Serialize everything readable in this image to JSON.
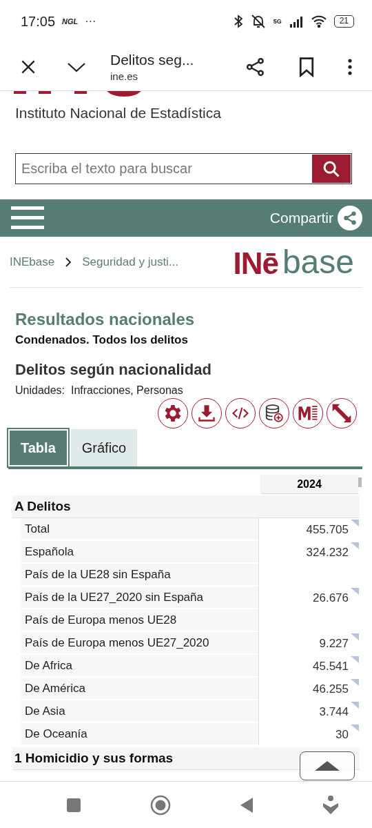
{
  "status_bar": {
    "time": "17:05",
    "carrier": "NGL",
    "more": "···",
    "network": "5G",
    "battery": "21"
  },
  "browser": {
    "title": "Delitos seg...",
    "url": "ine.es"
  },
  "site": {
    "name": "Instituto Nacional de Estadística",
    "search_placeholder": "Escriba el texto para buscar",
    "share_label": "Compartir"
  },
  "breadcrumb": [
    {
      "label": "INEbase"
    },
    {
      "label": "Seguridad y justi..."
    }
  ],
  "logo": {
    "left": "INē",
    "right": "base"
  },
  "section_title": "Resultados nacionales",
  "subtitle": "Condenados. Todos los delitos",
  "table_title": "Delitos según nacionalidad",
  "units_label": "Unidades:",
  "units": "Infracciones, Personas",
  "tools": [
    {
      "kind": "settings"
    },
    {
      "kind": "download"
    },
    {
      "kind": "embed"
    },
    {
      "kind": "database"
    },
    {
      "kind": "metadata"
    },
    {
      "kind": "expand"
    }
  ],
  "tabs": [
    {
      "label": "Tabla",
      "selected": true
    },
    {
      "label": "Gráfico",
      "selected": false
    }
  ],
  "table": {
    "columns": [
      "2024"
    ],
    "groups": [
      {
        "label": "A Delitos",
        "rows": [
          {
            "label": "Total",
            "value": "455.705"
          },
          {
            "label": "Española",
            "value": "324.232"
          },
          {
            "label": "País de la UE28 sin España"
          },
          {
            "label": "País de la UE27_2020 sin España",
            "value": "26.676"
          },
          {
            "label": "País de Europa menos UE28"
          },
          {
            "label": "País de Europa menos UE27_2020",
            "value": "9.227"
          },
          {
            "label": "De Africa",
            "value": "45.541"
          },
          {
            "label": "De América",
            "value": "46.255"
          },
          {
            "label": "De Asia",
            "value": "3.744"
          },
          {
            "label": "De Oceanía",
            "value": "30"
          }
        ]
      },
      {
        "label": "1 Homicidio y sus formas"
      }
    ]
  }
}
